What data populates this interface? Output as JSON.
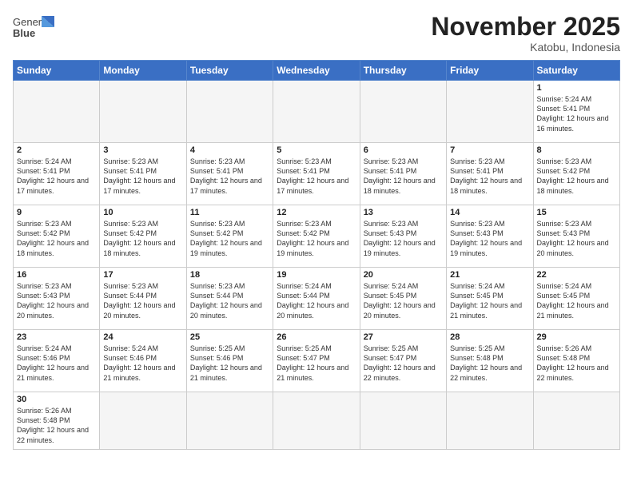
{
  "header": {
    "logo_line1": "General",
    "logo_line2": "Blue",
    "month_year": "November 2025",
    "location": "Katobu, Indonesia"
  },
  "weekdays": [
    "Sunday",
    "Monday",
    "Tuesday",
    "Wednesday",
    "Thursday",
    "Friday",
    "Saturday"
  ],
  "weeks": [
    [
      {
        "day": "",
        "empty": true
      },
      {
        "day": "",
        "empty": true
      },
      {
        "day": "",
        "empty": true
      },
      {
        "day": "",
        "empty": true
      },
      {
        "day": "",
        "empty": true
      },
      {
        "day": "",
        "empty": true
      },
      {
        "day": "1",
        "sunrise": "5:24 AM",
        "sunset": "5:41 PM",
        "daylight": "12 hours and 16 minutes."
      }
    ],
    [
      {
        "day": "2",
        "sunrise": "5:24 AM",
        "sunset": "5:41 PM",
        "daylight": "12 hours and 17 minutes."
      },
      {
        "day": "3",
        "sunrise": "5:23 AM",
        "sunset": "5:41 PM",
        "daylight": "12 hours and 17 minutes."
      },
      {
        "day": "4",
        "sunrise": "5:23 AM",
        "sunset": "5:41 PM",
        "daylight": "12 hours and 17 minutes."
      },
      {
        "day": "5",
        "sunrise": "5:23 AM",
        "sunset": "5:41 PM",
        "daylight": "12 hours and 17 minutes."
      },
      {
        "day": "6",
        "sunrise": "5:23 AM",
        "sunset": "5:41 PM",
        "daylight": "12 hours and 18 minutes."
      },
      {
        "day": "7",
        "sunrise": "5:23 AM",
        "sunset": "5:41 PM",
        "daylight": "12 hours and 18 minutes."
      },
      {
        "day": "8",
        "sunrise": "5:23 AM",
        "sunset": "5:42 PM",
        "daylight": "12 hours and 18 minutes."
      }
    ],
    [
      {
        "day": "9",
        "sunrise": "5:23 AM",
        "sunset": "5:42 PM",
        "daylight": "12 hours and 18 minutes."
      },
      {
        "day": "10",
        "sunrise": "5:23 AM",
        "sunset": "5:42 PM",
        "daylight": "12 hours and 18 minutes."
      },
      {
        "day": "11",
        "sunrise": "5:23 AM",
        "sunset": "5:42 PM",
        "daylight": "12 hours and 19 minutes."
      },
      {
        "day": "12",
        "sunrise": "5:23 AM",
        "sunset": "5:42 PM",
        "daylight": "12 hours and 19 minutes."
      },
      {
        "day": "13",
        "sunrise": "5:23 AM",
        "sunset": "5:43 PM",
        "daylight": "12 hours and 19 minutes."
      },
      {
        "day": "14",
        "sunrise": "5:23 AM",
        "sunset": "5:43 PM",
        "daylight": "12 hours and 19 minutes."
      },
      {
        "day": "15",
        "sunrise": "5:23 AM",
        "sunset": "5:43 PM",
        "daylight": "12 hours and 20 minutes."
      }
    ],
    [
      {
        "day": "16",
        "sunrise": "5:23 AM",
        "sunset": "5:43 PM",
        "daylight": "12 hours and 20 minutes."
      },
      {
        "day": "17",
        "sunrise": "5:23 AM",
        "sunset": "5:44 PM",
        "daylight": "12 hours and 20 minutes."
      },
      {
        "day": "18",
        "sunrise": "5:23 AM",
        "sunset": "5:44 PM",
        "daylight": "12 hours and 20 minutes."
      },
      {
        "day": "19",
        "sunrise": "5:24 AM",
        "sunset": "5:44 PM",
        "daylight": "12 hours and 20 minutes."
      },
      {
        "day": "20",
        "sunrise": "5:24 AM",
        "sunset": "5:45 PM",
        "daylight": "12 hours and 20 minutes."
      },
      {
        "day": "21",
        "sunrise": "5:24 AM",
        "sunset": "5:45 PM",
        "daylight": "12 hours and 21 minutes."
      },
      {
        "day": "22",
        "sunrise": "5:24 AM",
        "sunset": "5:45 PM",
        "daylight": "12 hours and 21 minutes."
      }
    ],
    [
      {
        "day": "23",
        "sunrise": "5:24 AM",
        "sunset": "5:46 PM",
        "daylight": "12 hours and 21 minutes."
      },
      {
        "day": "24",
        "sunrise": "5:24 AM",
        "sunset": "5:46 PM",
        "daylight": "12 hours and 21 minutes."
      },
      {
        "day": "25",
        "sunrise": "5:25 AM",
        "sunset": "5:46 PM",
        "daylight": "12 hours and 21 minutes."
      },
      {
        "day": "26",
        "sunrise": "5:25 AM",
        "sunset": "5:47 PM",
        "daylight": "12 hours and 21 minutes."
      },
      {
        "day": "27",
        "sunrise": "5:25 AM",
        "sunset": "5:47 PM",
        "daylight": "12 hours and 22 minutes."
      },
      {
        "day": "28",
        "sunrise": "5:25 AM",
        "sunset": "5:48 PM",
        "daylight": "12 hours and 22 minutes."
      },
      {
        "day": "29",
        "sunrise": "5:26 AM",
        "sunset": "5:48 PM",
        "daylight": "12 hours and 22 minutes."
      }
    ],
    [
      {
        "day": "30",
        "sunrise": "5:26 AM",
        "sunset": "5:48 PM",
        "daylight": "12 hours and 22 minutes."
      },
      {
        "day": "",
        "empty": true
      },
      {
        "day": "",
        "empty": true
      },
      {
        "day": "",
        "empty": true
      },
      {
        "day": "",
        "empty": true
      },
      {
        "day": "",
        "empty": true
      },
      {
        "day": "",
        "empty": true
      }
    ]
  ]
}
